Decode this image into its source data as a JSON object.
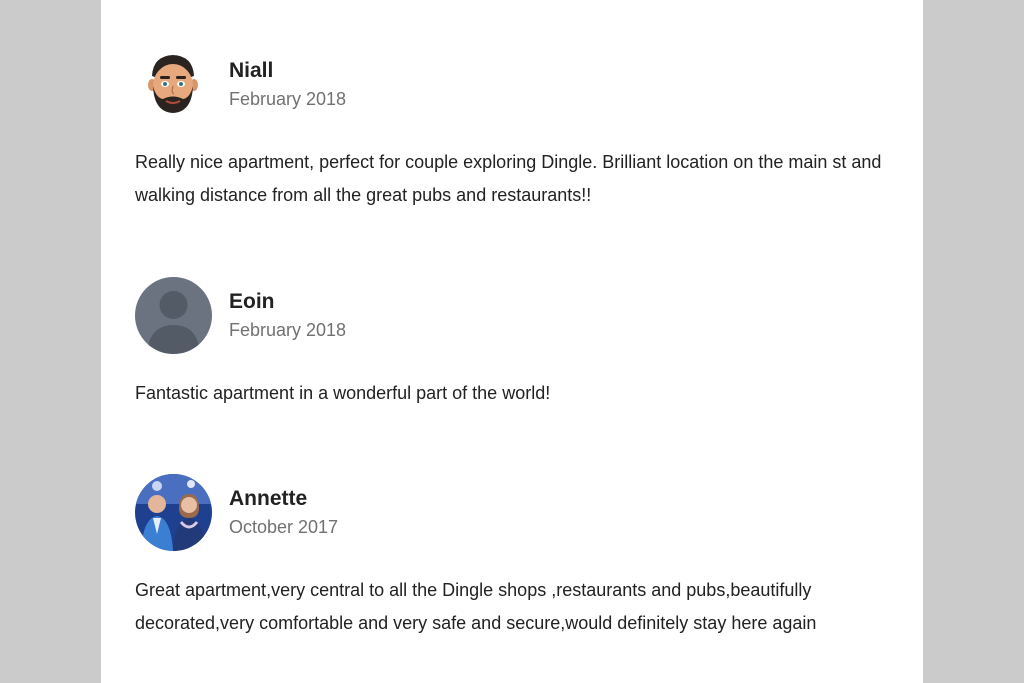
{
  "reviews": [
    {
      "name": "Niall",
      "date": "February 2018",
      "text": "Really nice apartment, perfect for couple exploring Dingle. Brilliant location on the main st and walking distance from all the great pubs and restaurants!!",
      "avatar": "bearded-man-emoji-avatar"
    },
    {
      "name": "Eoin",
      "date": "February 2018",
      "text": "Fantastic apartment in a wonderful part of the world!",
      "avatar": "default-silhouette-avatar"
    },
    {
      "name": "Annette",
      "date": "October 2017",
      "text": "Great apartment,very central to all the Dingle shops ,restaurants and pubs,beautifully decorated,very comfortable and very safe and secure,would definitely stay here again",
      "avatar": "couple-photo-avatar"
    }
  ],
  "colors": {
    "background": "#cbcbcb",
    "panel": "#ffffff",
    "text": "#222222",
    "muted": "#717171",
    "default_avatar": "#6b7280"
  }
}
